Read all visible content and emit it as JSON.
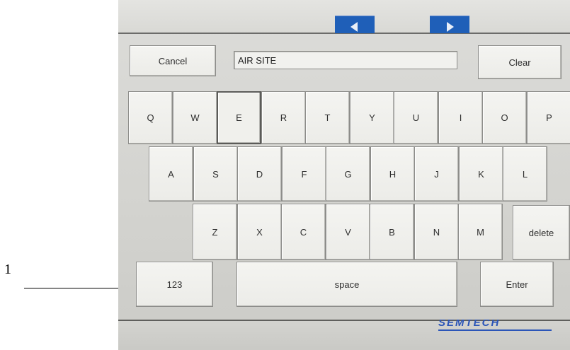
{
  "callout": {
    "number": "1"
  },
  "toolbar": {
    "cancel_label": "Cancel",
    "clear_label": "Clear"
  },
  "input": {
    "value": "AIR SITE"
  },
  "keyboard": {
    "row1": [
      "Q",
      "W",
      "E",
      "R",
      "T",
      "Y",
      "U",
      "I",
      "O",
      "P"
    ],
    "row2": [
      "A",
      "S",
      "D",
      "F",
      "G",
      "H",
      "J",
      "K",
      "L"
    ],
    "row3": [
      "Z",
      "X",
      "C",
      "V",
      "B",
      "N",
      "M"
    ],
    "delete_label": "delete",
    "numbers_label": "123",
    "space_label": "space",
    "enter_label": "Enter",
    "pressed_key": "E"
  },
  "nav": {
    "prev_icon": "arrow-left-icon",
    "next_icon": "arrow-right-icon"
  },
  "logo": {
    "text": "SEMTECH"
  },
  "colors": {
    "nav_button": "#1f5fb8",
    "screen_bg": "#d6d6d2",
    "key_bg": "#f2f2ef"
  }
}
